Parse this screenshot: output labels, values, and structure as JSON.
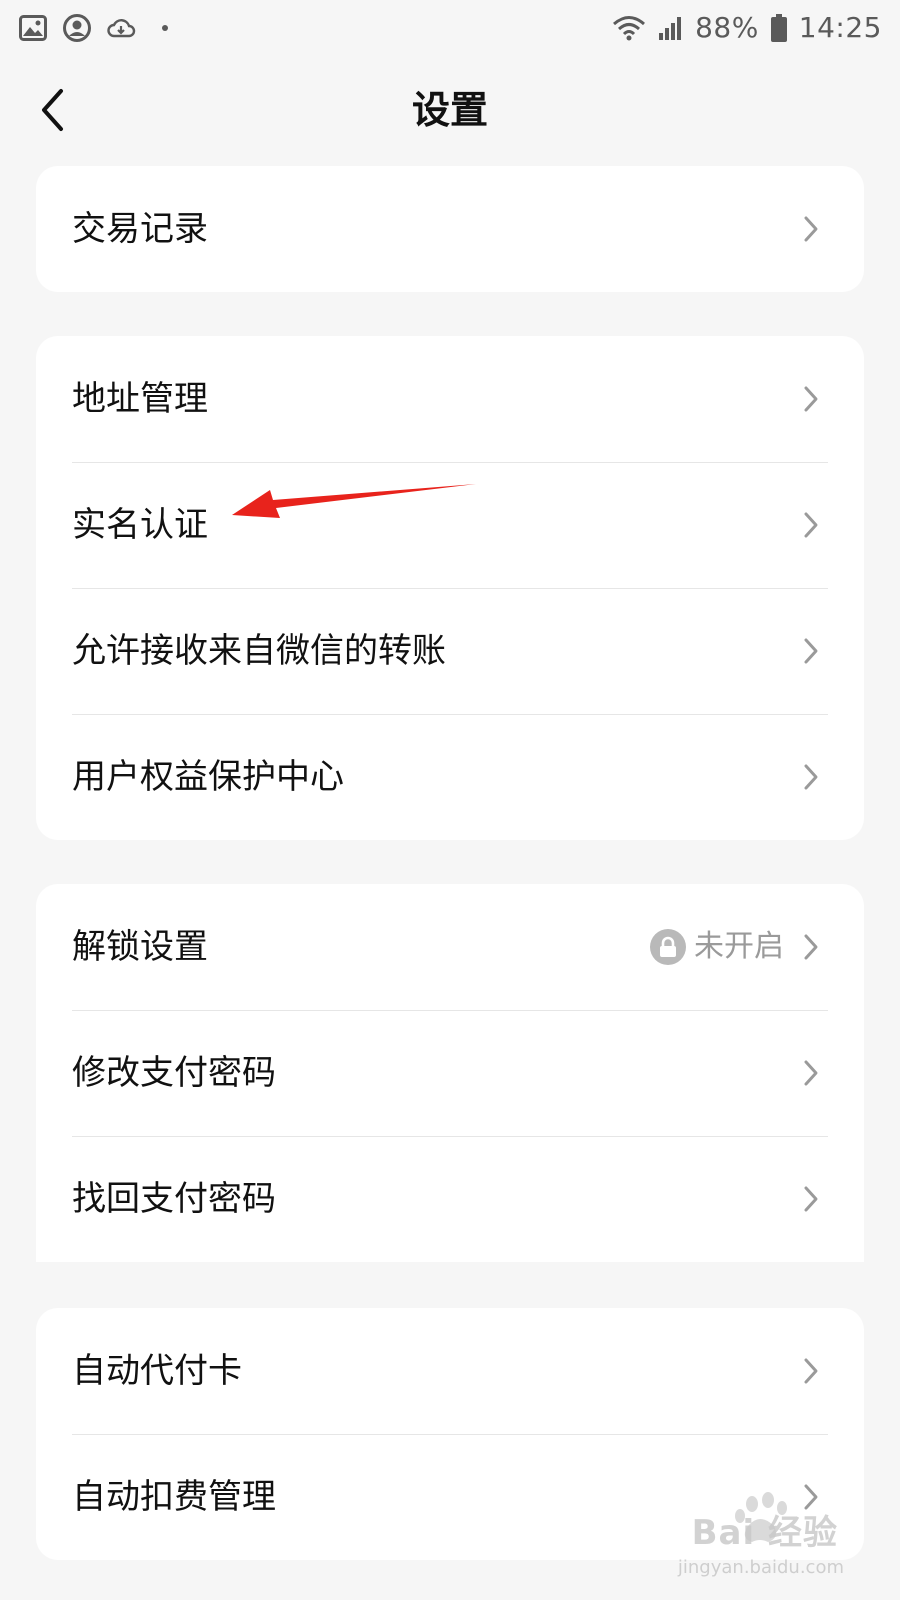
{
  "status_bar": {
    "battery": "88%",
    "time": "14:25",
    "icons": [
      "image-icon",
      "account-icon",
      "cloud-icon",
      "dot-icon",
      "wifi-icon",
      "signal-icon",
      "battery-icon"
    ]
  },
  "header": {
    "title": "设置"
  },
  "groups": [
    {
      "items": [
        {
          "label": "交易记录"
        }
      ]
    },
    {
      "items": [
        {
          "label": "地址管理"
        },
        {
          "label": "实名认证"
        },
        {
          "label": "允许接收来自微信的转账"
        },
        {
          "label": "用户权益保护中心"
        }
      ]
    },
    {
      "items": [
        {
          "label": "解锁设置",
          "status": "未开启"
        },
        {
          "label": "修改支付密码"
        },
        {
          "label": "找回支付密码"
        }
      ]
    },
    {
      "items": [
        {
          "label": "自动代付卡"
        },
        {
          "label": "自动扣费管理"
        }
      ]
    }
  ],
  "watermark": {
    "brand": "Bai 经验",
    "site": "jingyan.baidu.com"
  },
  "colors": {
    "background": "#f6f6f6",
    "card": "#ffffff",
    "text": "#111111",
    "chevron": "#9a9a9a",
    "status_text": "#9a9a9a",
    "arrow": "#e8231c"
  }
}
